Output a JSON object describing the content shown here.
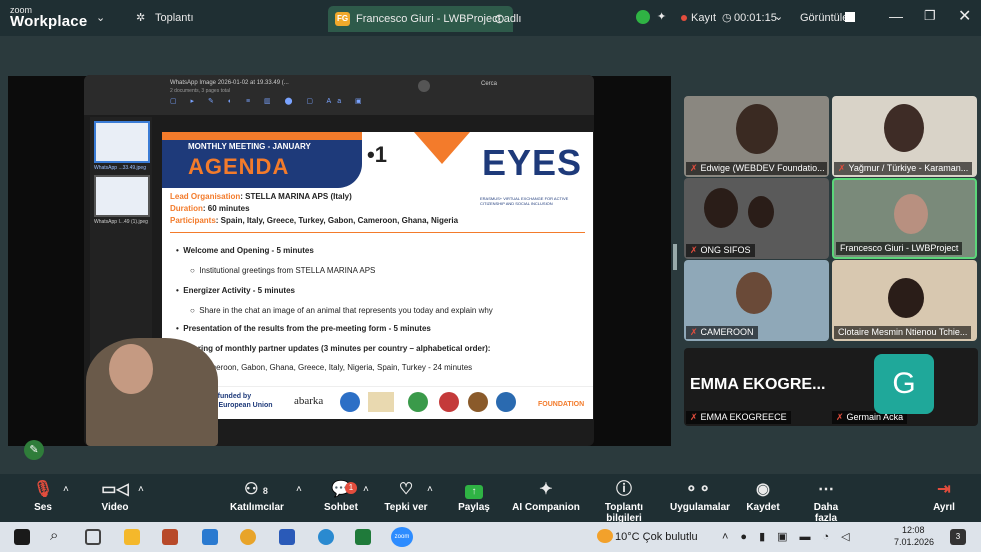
{
  "titlebar": {
    "zoom_small": "zoom",
    "zoom_big": "Workplace",
    "meeting_label": "Toplantı",
    "share_tab": "Francesco Giuri - LWBProject adlı",
    "fg_initials": "FG",
    "record": "Kayıt",
    "timer": "00:01:15",
    "view": "Görüntüle"
  },
  "viewer": {
    "file_title": "WhatsApp Image 2026-01-02 at 19.33.49 (...",
    "file_sub": "2 documents, 3 pages total",
    "thumb1": "WhatsApp ...33.49.jpeg",
    "thumb2": "WhatsApp I...49 (1).jpeg",
    "search": "Cerca"
  },
  "slide": {
    "monthly": "MONTHLY MEETING - JANUARY",
    "agenda": "AGENDA",
    "num": "•1",
    "eyes": "EYES",
    "eyes_sub": "ERASMUS+ VIRTUAL EXCHANGE FOR ACTIVE CITIZENSHIP AND SOCIAL INCLUSION",
    "lead_k": "Lead Organisation",
    "lead_v": ": STELLA MARINA APS (Italy)",
    "dur_k": "Duration",
    "dur_v": ": 60 minutes",
    "part_k": "Participants",
    "part_v": ": Spain, Italy, Greece, Turkey, Gabon, Cameroon, Ghana, Nigeria",
    "b1": "Welcome and Opening -  5 minutes",
    "b1s": "Institutional greetings from STELLA MARINA APS",
    "b2": "Energizer Activity - 5 minutes",
    "b2s": "Share in the chat an image of an animal that represents you today and explain why",
    "b3": "Presentation of the results from the pre-meeting form - 5 minutes",
    "b4": "Sharing of monthly partner updates (3 minutes per country – alphabetical order):",
    "b4s": "Cameroon, Gabon, Ghana, Greece, Italy, Nigeria, Spain, Turkey - 24 minutes",
    "cofund1": "Co-funded by",
    "cofund2": "the European Union",
    "abarka": "abarka",
    "foundation": "FOUNDATION"
  },
  "tiles": [
    {
      "name": "Edwige (WEBDEV Foundatio..."
    },
    {
      "name": "Yağmur / Türkiye - Karaman..."
    },
    {
      "name": "ONG SIFOS"
    },
    {
      "name": "Francesco Giuri - LWBProject"
    },
    {
      "name": "CAMEROON"
    },
    {
      "name": "Clotaire Mesmin Ntienou Tchie..."
    }
  ],
  "emma": {
    "big": "EMMA  EKOGRE...",
    "name": "EMMA EKOGREECE",
    "g": "G",
    "gname": "Germain Acka"
  },
  "controls": {
    "audio": "Ses",
    "video": "Video",
    "participants": "Katılımcılar",
    "participant_count": "8",
    "chat": "Sohbet",
    "chat_badge": "1",
    "react": "Tepki ver",
    "share": "Paylaş",
    "ai": "AI Companion",
    "summary": "Toplantı bilgileri",
    "apps": "Uygulamalar",
    "record": "Kaydet",
    "more": "Daha fazla",
    "leave": "Ayrıl"
  },
  "taskbar": {
    "weather": "10°C  Çok bulutlu",
    "time": "12:08",
    "date": "7.01.2026",
    "notif": "3",
    "zoom_app": "zoom"
  }
}
